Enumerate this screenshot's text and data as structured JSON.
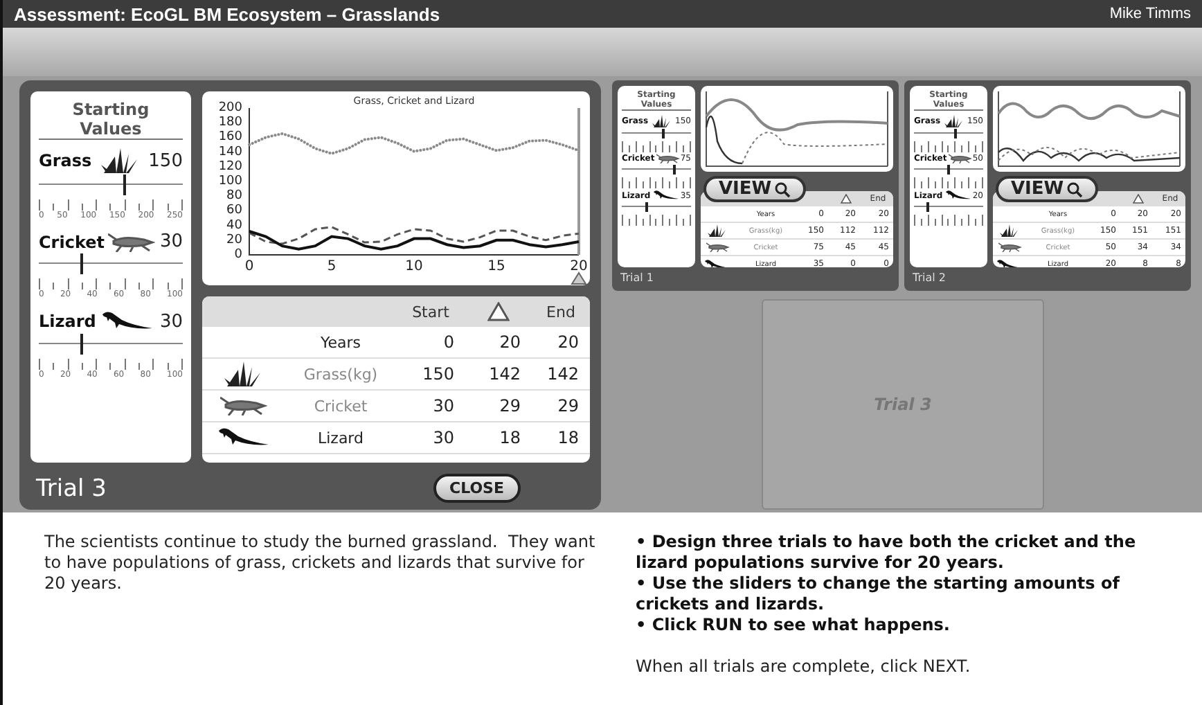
{
  "header": {
    "title": "Assessment: EcoGL BM Ecosystem – Grasslands",
    "user": "Mike Timms"
  },
  "current_trial": {
    "label": "Trial 3",
    "close_button": "CLOSE",
    "starting_values": {
      "title": "Starting Values",
      "sliders": [
        {
          "name": "Grass",
          "kind": "grass",
          "value": "150",
          "level": 0.6,
          "ticks": [
            "0",
            "50",
            "100",
            "150",
            "200",
            "250"
          ]
        },
        {
          "name": "Cricket",
          "kind": "cricket",
          "value": "30",
          "level": 0.3,
          "ticks": [
            "0",
            "20",
            "40",
            "60",
            "80",
            "100"
          ]
        },
        {
          "name": "Lizard",
          "kind": "lizard",
          "value": "30",
          "level": 0.3,
          "ticks": [
            "0",
            "20",
            "40",
            "60",
            "80",
            "100"
          ]
        }
      ]
    },
    "chart": {
      "chart_data": {
        "type": "line",
        "title": "Grass, Cricket and Lizard",
        "x": [
          0,
          1,
          2,
          3,
          4,
          5,
          6,
          7,
          8,
          9,
          10,
          11,
          12,
          13,
          14,
          15,
          16,
          17,
          18,
          19,
          20
        ],
        "xlim": [
          0,
          20
        ],
        "ylim": [
          0,
          200
        ],
        "xticks": [
          0,
          5,
          10,
          15,
          20
        ],
        "yticks": [
          0,
          20,
          40,
          60,
          80,
          100,
          120,
          140,
          160,
          180,
          200
        ],
        "series": [
          {
            "line_style": "dotted",
            "color": "#8a8a8a",
            "values": [
              150,
              160,
              165,
              158,
              145,
              138,
              145,
              157,
              160,
              152,
              141,
              145,
              156,
              158,
              150,
              142,
              146,
              155,
              156,
              150,
              142
            ]
          },
          {
            "line_style": "dashed",
            "color": "#555555",
            "values": [
              30,
              18,
              15,
              22,
              35,
              38,
              28,
              17,
              18,
              28,
              35,
              33,
              22,
              18,
              24,
              33,
              33,
              25,
              20,
              26,
              29
            ]
          },
          {
            "line_style": "solid",
            "color": "#111111",
            "values": [
              32,
              25,
              12,
              8,
              12,
              25,
              22,
              12,
              8,
              12,
              22,
              22,
              14,
              10,
              12,
              20,
              20,
              14,
              11,
              14,
              18
            ]
          }
        ]
      }
    },
    "table": {
      "columns": [
        "Start",
        "End"
      ],
      "rows": [
        {
          "kind": "years",
          "label": "Years",
          "start": "0",
          "delta": "20",
          "end": "20"
        },
        {
          "kind": "grass",
          "label": "Grass(kg)",
          "start": "150",
          "delta": "142",
          "end": "142"
        },
        {
          "kind": "cricket",
          "label": "Cricket",
          "start": "30",
          "delta": "29",
          "end": "29"
        },
        {
          "kind": "lizard",
          "label": "Lizard",
          "start": "30",
          "delta": "18",
          "end": "18"
        }
      ]
    }
  },
  "trials": [
    {
      "label": "Trial 1",
      "kind": "damped",
      "view_button": "VIEW",
      "starting_values_title": "Starting Values",
      "end_column": "End",
      "sliders": [
        {
          "name": "Grass",
          "kind": "grass",
          "value": "150",
          "level": 0.6
        },
        {
          "name": "Cricket",
          "kind": "cricket",
          "value": "75",
          "level": 0.75
        },
        {
          "name": "Lizard",
          "kind": "lizard",
          "value": "35",
          "level": 0.35
        }
      ],
      "rows": [
        {
          "kind": "years",
          "label": "Years",
          "start": "0",
          "delta": "20",
          "end": "20"
        },
        {
          "kind": "grass",
          "label": "Grass(kg)",
          "start": "150",
          "delta": "112",
          "end": "112"
        },
        {
          "kind": "cricket",
          "label": "Cricket",
          "start": "75",
          "delta": "45",
          "end": "45"
        },
        {
          "kind": "lizard",
          "label": "Lizard",
          "start": "35",
          "delta": "0",
          "end": "0"
        }
      ]
    },
    {
      "label": "Trial 2",
      "kind": "cycling",
      "view_button": "VIEW",
      "starting_values_title": "Starting Values",
      "end_column": "End",
      "sliders": [
        {
          "name": "Grass",
          "kind": "grass",
          "value": "150",
          "level": 0.6
        },
        {
          "name": "Cricket",
          "kind": "cricket",
          "value": "50",
          "level": 0.5
        },
        {
          "name": "Lizard",
          "kind": "lizard",
          "value": "20",
          "level": 0.2
        }
      ],
      "rows": [
        {
          "kind": "years",
          "label": "Years",
          "start": "0",
          "delta": "20",
          "end": "20"
        },
        {
          "kind": "grass",
          "label": "Grass(kg)",
          "start": "150",
          "delta": "151",
          "end": "151"
        },
        {
          "kind": "cricket",
          "label": "Cricket",
          "start": "50",
          "delta": "34",
          "end": "34"
        },
        {
          "kind": "lizard",
          "label": "Lizard",
          "start": "20",
          "delta": "8",
          "end": "8"
        }
      ]
    }
  ],
  "empty_trial": {
    "label": "Trial 3"
  },
  "description": "The scientists continue to study the burned grassland.  They want to have populations of grass, crickets and lizards that survive for 20 years.",
  "instructions": [
    "• Design three trials to have both the cricket and the lizard populations survive for 20 years.",
    "• Use the sliders to change the starting amounts of crickets and lizards.",
    "• Click RUN to see what happens."
  ],
  "footer_note": "When all trials are complete, click NEXT."
}
